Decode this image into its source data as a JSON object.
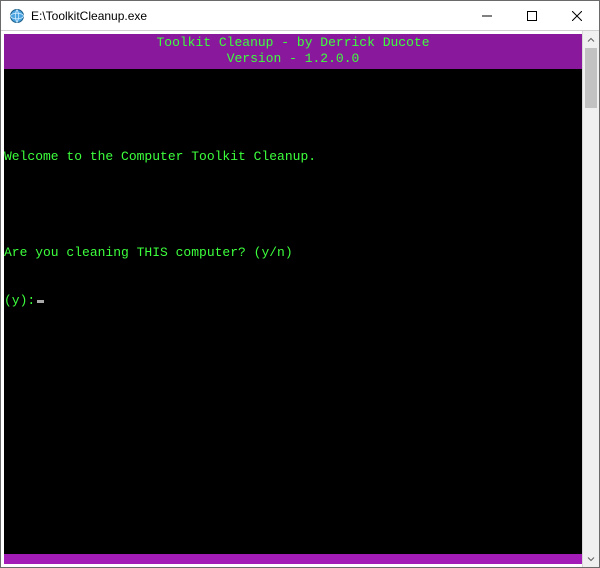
{
  "window": {
    "title": "E:\\ToolkitCleanup.exe"
  },
  "banner": {
    "line1": "Toolkit Cleanup - by Derrick Ducote",
    "line2": "Version - 1.2.0.0"
  },
  "console": {
    "welcome": "Welcome to the Computer Toolkit Cleanup.",
    "question": "Are you cleaning THIS computer? (y/n)",
    "prompt": "(y):"
  },
  "colors": {
    "banner_bg": "#8a189c",
    "footer_bg": "#a41cb8",
    "term_green": "#3cff3c",
    "term_bg": "#000000"
  }
}
